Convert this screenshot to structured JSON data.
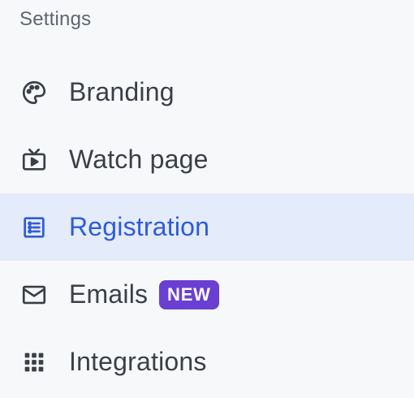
{
  "settings": {
    "title": "Settings",
    "items": [
      {
        "label": "Branding",
        "icon": "palette-icon"
      },
      {
        "label": "Watch page",
        "icon": "tv-icon"
      },
      {
        "label": "Registration",
        "icon": "list-icon",
        "active": true
      },
      {
        "label": "Emails",
        "icon": "mail-icon",
        "badge": "NEW"
      },
      {
        "label": "Integrations",
        "icon": "grid-icon"
      }
    ]
  },
  "colors": {
    "background": "#f7f8fa",
    "active_background": "#e4ebfa",
    "active_text": "#2f5bd9",
    "text": "#3b3f46",
    "badge": "#6a3fd1"
  }
}
